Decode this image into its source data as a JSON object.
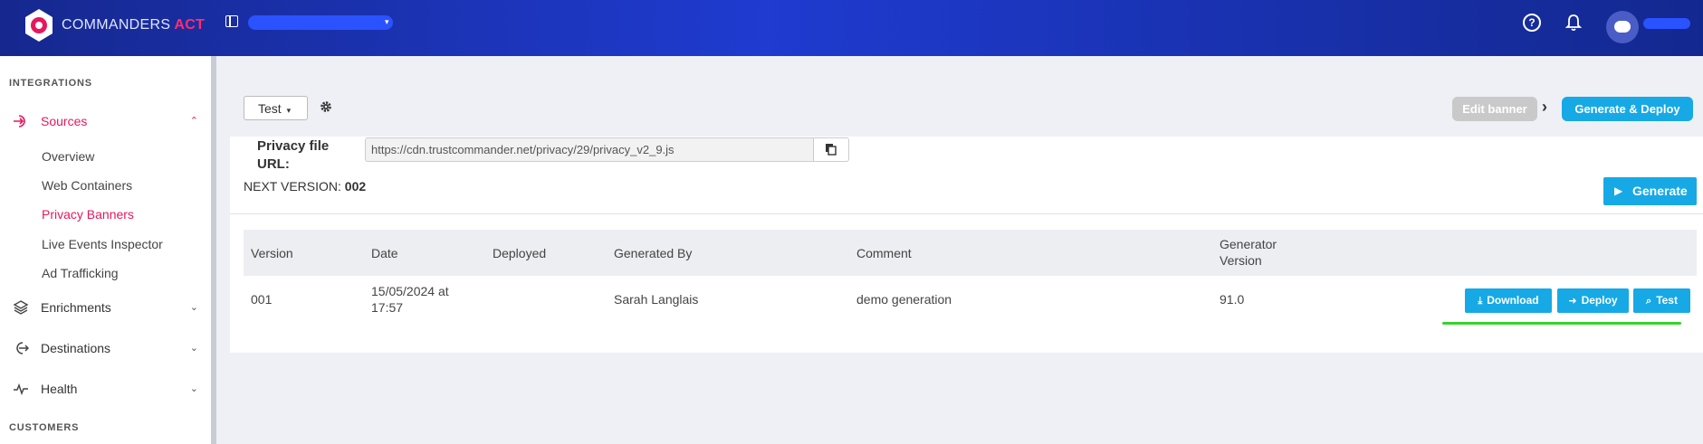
{
  "header": {
    "brand_name": "COMMANDERS",
    "brand_suffix": "ACT",
    "account_caret": "▾",
    "help_icon": "?",
    "colors": {
      "brand_accent": "#ff2d6f",
      "header_bg": "#1f3bd0"
    }
  },
  "sidebar": {
    "section_integrations": "INTEGRATIONS",
    "section_customers": "CUSTOMERS",
    "sources": {
      "label": "Sources",
      "chevron": "⌃"
    },
    "subitems": [
      {
        "label": "Overview"
      },
      {
        "label": "Web Containers"
      },
      {
        "label": "Privacy Banners"
      },
      {
        "label": "Live Events Inspector"
      },
      {
        "label": "Ad Trafficking"
      }
    ],
    "enrichments": {
      "label": "Enrichments",
      "chevron": "⌄"
    },
    "destinations": {
      "label": "Destinations",
      "chevron": "⌄"
    },
    "health": {
      "label": "Health",
      "chevron": "⌄"
    },
    "colors": {
      "active": "#e8175d"
    }
  },
  "toolbar": {
    "env_label": "Test",
    "env_caret": "▾",
    "edit_banner_label": "Edit banner",
    "step_arrow": "›",
    "generate_deploy_label": "Generate & Deploy"
  },
  "main": {
    "url_label": "Privacy file URL:",
    "url_value": "https://cdn.trustcommander.net/privacy/29/privacy_v2_9.js",
    "next_version_label": "NEXT VERSION:",
    "next_version_value": "002",
    "generate_label": "Generate",
    "colors": {
      "button_blue": "#16a9e6"
    }
  },
  "table": {
    "columns": [
      "Version",
      "Date",
      "Deployed",
      "Generated By",
      "Comment",
      "Generator Version"
    ],
    "rows": [
      {
        "version": "001",
        "date": "15/05/2024 at 17:57",
        "deployed": "",
        "generated_by": "Sarah Langlais",
        "comment": "demo generation",
        "generator_version": "91.0",
        "actions": {
          "download": "Download",
          "deploy": "Deploy",
          "test": "Test"
        }
      }
    ]
  }
}
